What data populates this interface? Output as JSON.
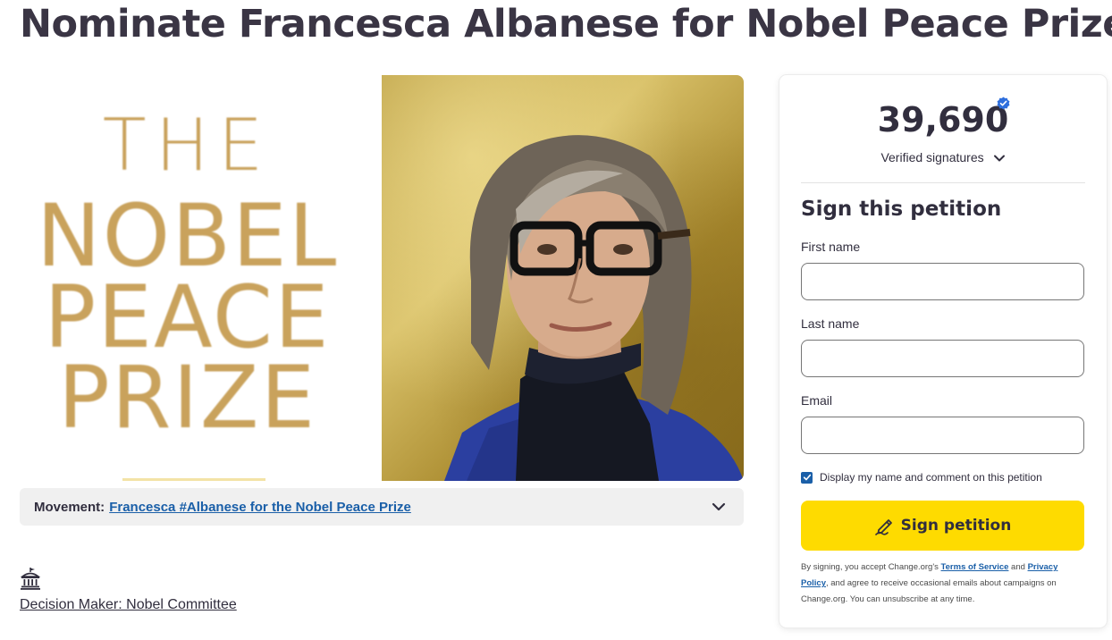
{
  "page": {
    "title": "Nominate Francesca Albanese for Nobel Peace Prize"
  },
  "hero": {
    "prize_lines": [
      "THE",
      "NOBEL",
      "PEACE",
      "PRIZE"
    ],
    "prize_color": "#c9a25c"
  },
  "movement": {
    "label": "Movement:",
    "link_text": "Francesca #Albanese for the Nobel Peace Prize",
    "icon": "chevron-down-icon"
  },
  "decision_maker": {
    "icon": "government-building-icon",
    "text": "Decision Maker: Nobel Committee"
  },
  "sign_card": {
    "count": "39,690",
    "verified_label": "Verified signatures",
    "heading": "Sign this petition",
    "first_name_label": "First name",
    "first_name_value": "",
    "last_name_label": "Last name",
    "last_name_value": "",
    "email_label": "Email",
    "email_value": "",
    "display_checkbox_label": "Display my name and comment on this petition",
    "display_checked": true,
    "button_label": "Sign petition",
    "button_color": "#fedb00",
    "legal": {
      "part1": "By signing, you accept Change.org's ",
      "terms": "Terms of Service",
      "part2": " and ",
      "privacy": "Privacy Policy",
      "part3": ", and agree to receive occasional emails about campaigns on Change.org. You can unsubscribe at any time."
    }
  }
}
